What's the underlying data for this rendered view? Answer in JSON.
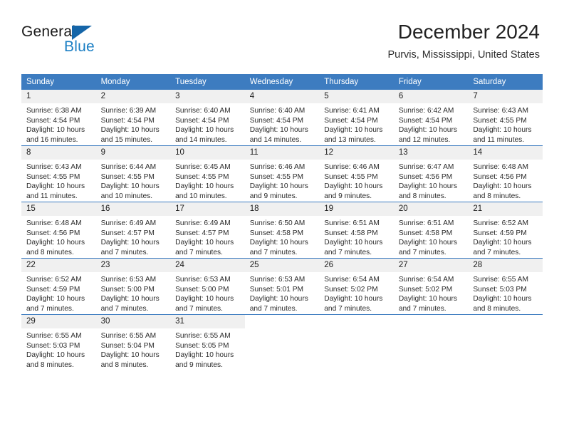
{
  "brand": {
    "name_part1": "General",
    "name_part2": "Blue",
    "triangle_color": "#1565a8",
    "blue_color": "#1b7fc4"
  },
  "header": {
    "title": "December 2024",
    "location": "Purvis, Mississippi, United States"
  },
  "theme": {
    "header_blue": "#3d7cc0",
    "daynum_band": "#f0f0f0",
    "text": "#2b2b2b"
  },
  "calendar": {
    "weekday_headers": [
      "Sunday",
      "Monday",
      "Tuesday",
      "Wednesday",
      "Thursday",
      "Friday",
      "Saturday"
    ],
    "weeks": [
      [
        {
          "day": "1",
          "sunrise": "Sunrise: 6:38 AM",
          "sunset": "Sunset: 4:54 PM",
          "daylight1": "Daylight: 10 hours",
          "daylight2": "and 16 minutes."
        },
        {
          "day": "2",
          "sunrise": "Sunrise: 6:39 AM",
          "sunset": "Sunset: 4:54 PM",
          "daylight1": "Daylight: 10 hours",
          "daylight2": "and 15 minutes."
        },
        {
          "day": "3",
          "sunrise": "Sunrise: 6:40 AM",
          "sunset": "Sunset: 4:54 PM",
          "daylight1": "Daylight: 10 hours",
          "daylight2": "and 14 minutes."
        },
        {
          "day": "4",
          "sunrise": "Sunrise: 6:40 AM",
          "sunset": "Sunset: 4:54 PM",
          "daylight1": "Daylight: 10 hours",
          "daylight2": "and 14 minutes."
        },
        {
          "day": "5",
          "sunrise": "Sunrise: 6:41 AM",
          "sunset": "Sunset: 4:54 PM",
          "daylight1": "Daylight: 10 hours",
          "daylight2": "and 13 minutes."
        },
        {
          "day": "6",
          "sunrise": "Sunrise: 6:42 AM",
          "sunset": "Sunset: 4:54 PM",
          "daylight1": "Daylight: 10 hours",
          "daylight2": "and 12 minutes."
        },
        {
          "day": "7",
          "sunrise": "Sunrise: 6:43 AM",
          "sunset": "Sunset: 4:55 PM",
          "daylight1": "Daylight: 10 hours",
          "daylight2": "and 11 minutes."
        }
      ],
      [
        {
          "day": "8",
          "sunrise": "Sunrise: 6:43 AM",
          "sunset": "Sunset: 4:55 PM",
          "daylight1": "Daylight: 10 hours",
          "daylight2": "and 11 minutes."
        },
        {
          "day": "9",
          "sunrise": "Sunrise: 6:44 AM",
          "sunset": "Sunset: 4:55 PM",
          "daylight1": "Daylight: 10 hours",
          "daylight2": "and 10 minutes."
        },
        {
          "day": "10",
          "sunrise": "Sunrise: 6:45 AM",
          "sunset": "Sunset: 4:55 PM",
          "daylight1": "Daylight: 10 hours",
          "daylight2": "and 10 minutes."
        },
        {
          "day": "11",
          "sunrise": "Sunrise: 6:46 AM",
          "sunset": "Sunset: 4:55 PM",
          "daylight1": "Daylight: 10 hours",
          "daylight2": "and 9 minutes."
        },
        {
          "day": "12",
          "sunrise": "Sunrise: 6:46 AM",
          "sunset": "Sunset: 4:55 PM",
          "daylight1": "Daylight: 10 hours",
          "daylight2": "and 9 minutes."
        },
        {
          "day": "13",
          "sunrise": "Sunrise: 6:47 AM",
          "sunset": "Sunset: 4:56 PM",
          "daylight1": "Daylight: 10 hours",
          "daylight2": "and 8 minutes."
        },
        {
          "day": "14",
          "sunrise": "Sunrise: 6:48 AM",
          "sunset": "Sunset: 4:56 PM",
          "daylight1": "Daylight: 10 hours",
          "daylight2": "and 8 minutes."
        }
      ],
      [
        {
          "day": "15",
          "sunrise": "Sunrise: 6:48 AM",
          "sunset": "Sunset: 4:56 PM",
          "daylight1": "Daylight: 10 hours",
          "daylight2": "and 8 minutes."
        },
        {
          "day": "16",
          "sunrise": "Sunrise: 6:49 AM",
          "sunset": "Sunset: 4:57 PM",
          "daylight1": "Daylight: 10 hours",
          "daylight2": "and 7 minutes."
        },
        {
          "day": "17",
          "sunrise": "Sunrise: 6:49 AM",
          "sunset": "Sunset: 4:57 PM",
          "daylight1": "Daylight: 10 hours",
          "daylight2": "and 7 minutes."
        },
        {
          "day": "18",
          "sunrise": "Sunrise: 6:50 AM",
          "sunset": "Sunset: 4:58 PM",
          "daylight1": "Daylight: 10 hours",
          "daylight2": "and 7 minutes."
        },
        {
          "day": "19",
          "sunrise": "Sunrise: 6:51 AM",
          "sunset": "Sunset: 4:58 PM",
          "daylight1": "Daylight: 10 hours",
          "daylight2": "and 7 minutes."
        },
        {
          "day": "20",
          "sunrise": "Sunrise: 6:51 AM",
          "sunset": "Sunset: 4:58 PM",
          "daylight1": "Daylight: 10 hours",
          "daylight2": "and 7 minutes."
        },
        {
          "day": "21",
          "sunrise": "Sunrise: 6:52 AM",
          "sunset": "Sunset: 4:59 PM",
          "daylight1": "Daylight: 10 hours",
          "daylight2": "and 7 minutes."
        }
      ],
      [
        {
          "day": "22",
          "sunrise": "Sunrise: 6:52 AM",
          "sunset": "Sunset: 4:59 PM",
          "daylight1": "Daylight: 10 hours",
          "daylight2": "and 7 minutes."
        },
        {
          "day": "23",
          "sunrise": "Sunrise: 6:53 AM",
          "sunset": "Sunset: 5:00 PM",
          "daylight1": "Daylight: 10 hours",
          "daylight2": "and 7 minutes."
        },
        {
          "day": "24",
          "sunrise": "Sunrise: 6:53 AM",
          "sunset": "Sunset: 5:00 PM",
          "daylight1": "Daylight: 10 hours",
          "daylight2": "and 7 minutes."
        },
        {
          "day": "25",
          "sunrise": "Sunrise: 6:53 AM",
          "sunset": "Sunset: 5:01 PM",
          "daylight1": "Daylight: 10 hours",
          "daylight2": "and 7 minutes."
        },
        {
          "day": "26",
          "sunrise": "Sunrise: 6:54 AM",
          "sunset": "Sunset: 5:02 PM",
          "daylight1": "Daylight: 10 hours",
          "daylight2": "and 7 minutes."
        },
        {
          "day": "27",
          "sunrise": "Sunrise: 6:54 AM",
          "sunset": "Sunset: 5:02 PM",
          "daylight1": "Daylight: 10 hours",
          "daylight2": "and 7 minutes."
        },
        {
          "day": "28",
          "sunrise": "Sunrise: 6:55 AM",
          "sunset": "Sunset: 5:03 PM",
          "daylight1": "Daylight: 10 hours",
          "daylight2": "and 8 minutes."
        }
      ],
      [
        {
          "day": "29",
          "sunrise": "Sunrise: 6:55 AM",
          "sunset": "Sunset: 5:03 PM",
          "daylight1": "Daylight: 10 hours",
          "daylight2": "and 8 minutes."
        },
        {
          "day": "30",
          "sunrise": "Sunrise: 6:55 AM",
          "sunset": "Sunset: 5:04 PM",
          "daylight1": "Daylight: 10 hours",
          "daylight2": "and 8 minutes."
        },
        {
          "day": "31",
          "sunrise": "Sunrise: 6:55 AM",
          "sunset": "Sunset: 5:05 PM",
          "daylight1": "Daylight: 10 hours",
          "daylight2": "and 9 minutes."
        },
        {
          "day": "",
          "sunrise": "",
          "sunset": "",
          "daylight1": "",
          "daylight2": ""
        },
        {
          "day": "",
          "sunrise": "",
          "sunset": "",
          "daylight1": "",
          "daylight2": ""
        },
        {
          "day": "",
          "sunrise": "",
          "sunset": "",
          "daylight1": "",
          "daylight2": ""
        },
        {
          "day": "",
          "sunrise": "",
          "sunset": "",
          "daylight1": "",
          "daylight2": ""
        }
      ]
    ]
  }
}
